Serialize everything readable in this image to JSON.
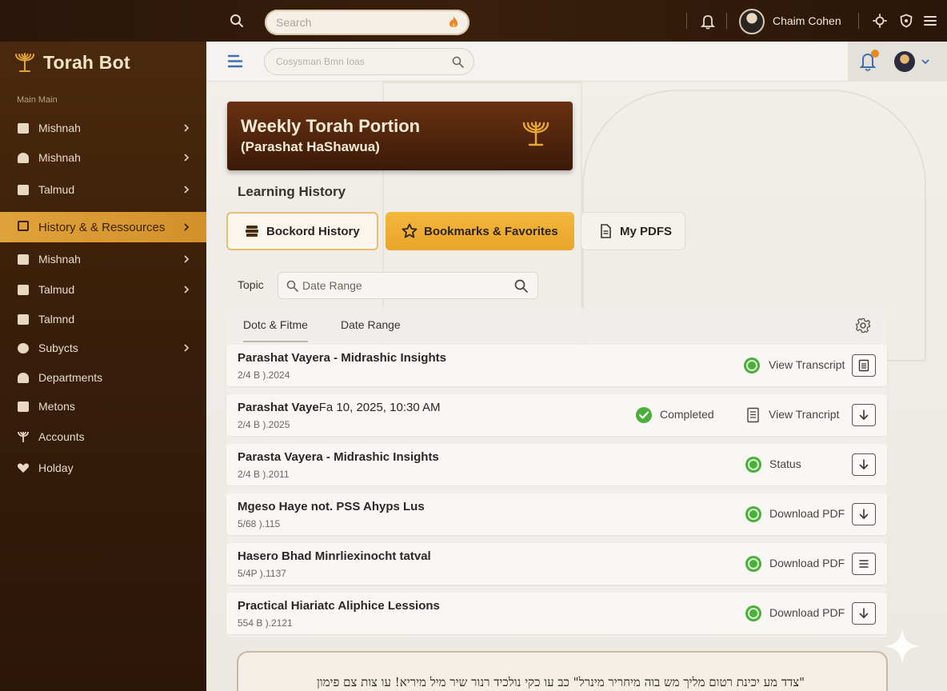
{
  "topbar": {
    "search_placeholder": "Search",
    "user_name": "Chaim Cohen"
  },
  "brand": {
    "name": "Torah Bot"
  },
  "sidebar": {
    "section_label": "Main Main",
    "items": [
      {
        "label": "Mishnah",
        "icon": "people-icon",
        "chevron": true
      },
      {
        "label": "Mishnah",
        "icon": "person-icon",
        "chevron": true
      },
      {
        "label": "Talmud",
        "icon": "book-icon",
        "chevron": true
      },
      {
        "label": "History & & Ressources",
        "icon": "history-icon",
        "chevron": true,
        "active": true
      },
      {
        "label": "Mishnah",
        "icon": "grid-icon",
        "chevron": true
      },
      {
        "label": "Talmud",
        "icon": "scroll-icon",
        "chevron": true
      },
      {
        "label": "Talmnd",
        "icon": "monitor-icon",
        "chevron": false
      },
      {
        "label": "Subycts",
        "icon": "puzzle-icon",
        "chevron": true
      },
      {
        "label": "Departments",
        "icon": "person-icon",
        "chevron": false
      },
      {
        "label": "Metons",
        "icon": "file-icon",
        "chevron": false
      },
      {
        "label": "Accounts",
        "icon": "menorah-icon",
        "chevron": false
      },
      {
        "label": "Holday",
        "icon": "heart-icon",
        "chevron": false
      }
    ]
  },
  "subheader": {
    "search_placeholder": "Cosysman Bmn Ioas"
  },
  "portion": {
    "title": "Weekly Torah Portion",
    "subtitle": "(Parashat HaShawua)"
  },
  "learning_history": {
    "title": "Learning History",
    "tabs": [
      {
        "label": "Bockord History",
        "icon": "stack-icon"
      },
      {
        "label": "Bookmarks & Favorites",
        "icon": "star-icon"
      },
      {
        "label": "My PDFS",
        "icon": "document-icon"
      }
    ],
    "topic_label": "Topic",
    "filter_placeholder": "Date Range",
    "columns": [
      "Dotc & Fitme",
      "Date Range"
    ],
    "rows": [
      {
        "title": "Parashat Vayera - Midrashic Insights",
        "date": "2/4 B ).2024",
        "status": "",
        "action": "View Transcript",
        "action_icon": "document-icon"
      },
      {
        "title": "Parashat Vaye",
        "title_suffix": "Fa 10, 2025, 10:30 AM",
        "date": "2/4 B ).2025",
        "status": "Completed",
        "action": "View Trancript",
        "action_icon": "download-icon"
      },
      {
        "title": "Parasta Vayera - Midrashic Insights",
        "date": "2/4 B ).2011",
        "status": "",
        "action": "Status",
        "action_icon": "download-icon"
      },
      {
        "title": "Mgeso Haye not. PSS Ahyps Lus",
        "date": "5/68 ).115",
        "status": "",
        "action": "Download PDF",
        "action_icon": "download-icon"
      },
      {
        "title": "Hasero Bhad Minrliexinocht tatval",
        "date": "5/4P ).1137",
        "status": "",
        "action": "Download PDF",
        "action_icon": "list-icon"
      },
      {
        "title": "Practical Hiariatc Aliphice Lessions",
        "date": "554 B ).2121",
        "status": "",
        "action": "Download PDF",
        "action_icon": "download-icon"
      }
    ]
  },
  "quote": {
    "text": "\"צדד מע יכינת רטום מליך מש בוה מיחריר מינרל\" כב עו כקי נולכיד רנור שיר מיל מיריא! עו צות צם פימון"
  },
  "colors": {
    "accent": "#e9a52a",
    "brand_dark": "#3a1f0a",
    "status_green": "#3fae3a"
  }
}
